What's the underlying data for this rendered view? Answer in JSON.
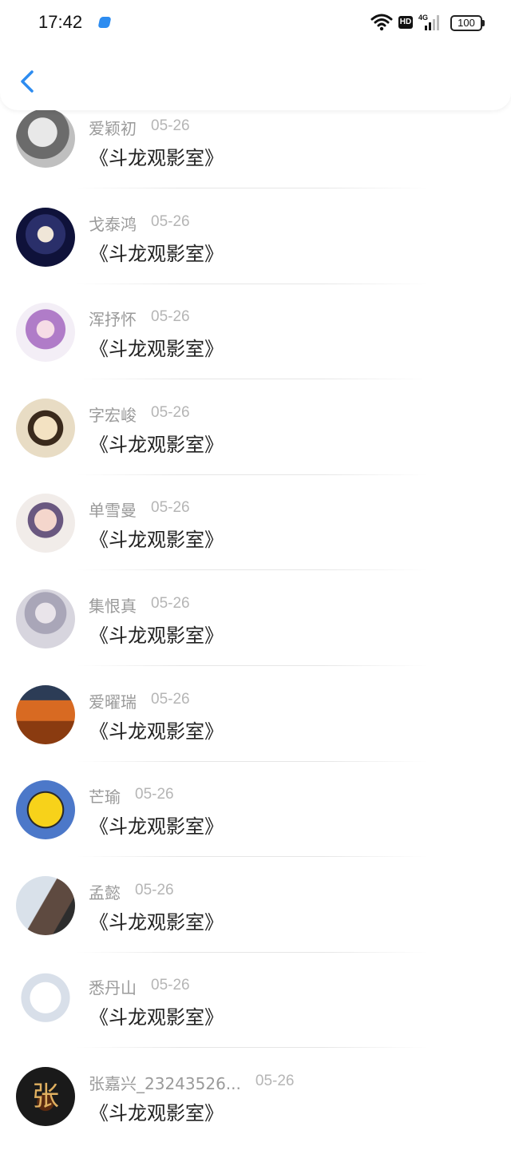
{
  "status_bar": {
    "time": "17:42",
    "battery": "100",
    "network": "4G",
    "hd": "HD"
  },
  "colors": {
    "accent": "#2d8cf0",
    "name_gray": "#9a9a9a",
    "date_gray": "#b5b5b5",
    "title": "#222222"
  },
  "header": {
    "back_icon": "chevron-left-icon"
  },
  "items": [
    {
      "name": "爱颖初",
      "date": "05-26",
      "title": "《斗龙观影室》"
    },
    {
      "name": "戈泰鸿",
      "date": "05-26",
      "title": "《斗龙观影室》"
    },
    {
      "name": "浑抒怀",
      "date": "05-26",
      "title": "《斗龙观影室》"
    },
    {
      "name": "字宏峻",
      "date": "05-26",
      "title": "《斗龙观影室》"
    },
    {
      "name": "单雪曼",
      "date": "05-26",
      "title": "《斗龙观影室》"
    },
    {
      "name": "集恨真",
      "date": "05-26",
      "title": "《斗龙观影室》"
    },
    {
      "name": "爱曜瑞",
      "date": "05-26",
      "title": "《斗龙观影室》"
    },
    {
      "name": "芒瑜",
      "date": "05-26",
      "title": "《斗龙观影室》"
    },
    {
      "name": "孟懿",
      "date": "05-26",
      "title": "《斗龙观影室》"
    },
    {
      "name": "悉丹山",
      "date": "05-26",
      "title": "《斗龙观影室》"
    },
    {
      "name": "张嘉兴_23243526...",
      "date": "05-26",
      "title": "《斗龙观影室》",
      "avatar_text": "张"
    }
  ]
}
